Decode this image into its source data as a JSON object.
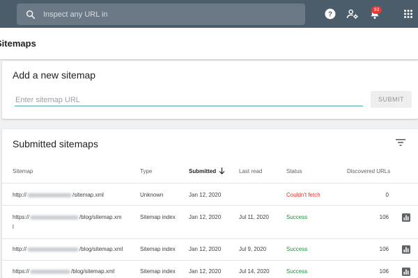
{
  "search": {
    "placeholder": "Inspect any URL in"
  },
  "header": {
    "notification_count": "93"
  },
  "page": {
    "title": "Sitemaps"
  },
  "add_sitemap": {
    "title": "Add a new sitemap",
    "input_placeholder": "Enter sitemap URL",
    "input_value": "",
    "submit_label": "SUBMIT"
  },
  "submitted": {
    "title": "Submitted sitemaps",
    "columns": {
      "sitemap": "Sitemap",
      "type": "Type",
      "submitted": "Submitted",
      "last_read": "Last read",
      "status": "Status",
      "discovered": "Discovered URLs"
    },
    "sorted_by": "submitted",
    "rows": [
      {
        "url_prefix": "http://",
        "url_suffix": "/sitemap.xml",
        "url_suffix2": "",
        "type": "Unknown",
        "submitted": "Jan 12, 2020",
        "last_read": "",
        "status": "Couldn't fetch",
        "status_kind": "error",
        "discovered": "0",
        "has_chart": false
      },
      {
        "url_prefix": "https://",
        "url_suffix": "/blog/sitemap.xm",
        "url_suffix2": "l",
        "type": "Sitemap index",
        "submitted": "Jan 12, 2020",
        "last_read": "Jul 11, 2020",
        "status": "Success",
        "status_kind": "success",
        "discovered": "106",
        "has_chart": true
      },
      {
        "url_prefix": "http://",
        "url_suffix": "/blog/sitemap.xml",
        "url_suffix2": "",
        "type": "Sitemap index",
        "submitted": "Jan 12, 2020",
        "last_read": "Jul 9, 2020",
        "status": "Success",
        "status_kind": "success",
        "discovered": "106",
        "has_chart": true
      },
      {
        "url_prefix": "https://",
        "url_suffix": "/blog/sitemap.xml",
        "url_suffix2": "",
        "type": "Sitemap index",
        "submitted": "Jan 12, 2020",
        "last_read": "Jul 14, 2020",
        "status": "Success",
        "status_kind": "success",
        "discovered": "106",
        "has_chart": true
      }
    ]
  },
  "colors": {
    "topbar": "#4b5c6b",
    "success": "#1e8e3e",
    "error": "#d93025",
    "accent": "#4ca4ae"
  },
  "icons": {
    "search": "search-icon",
    "help": "help-icon",
    "admin": "manage-accounts-icon",
    "notifications": "bell-icon",
    "apps": "apps-grid-icon",
    "filter": "filter-icon",
    "sort": "arrow-down-icon",
    "chart": "bar-chart-icon"
  }
}
